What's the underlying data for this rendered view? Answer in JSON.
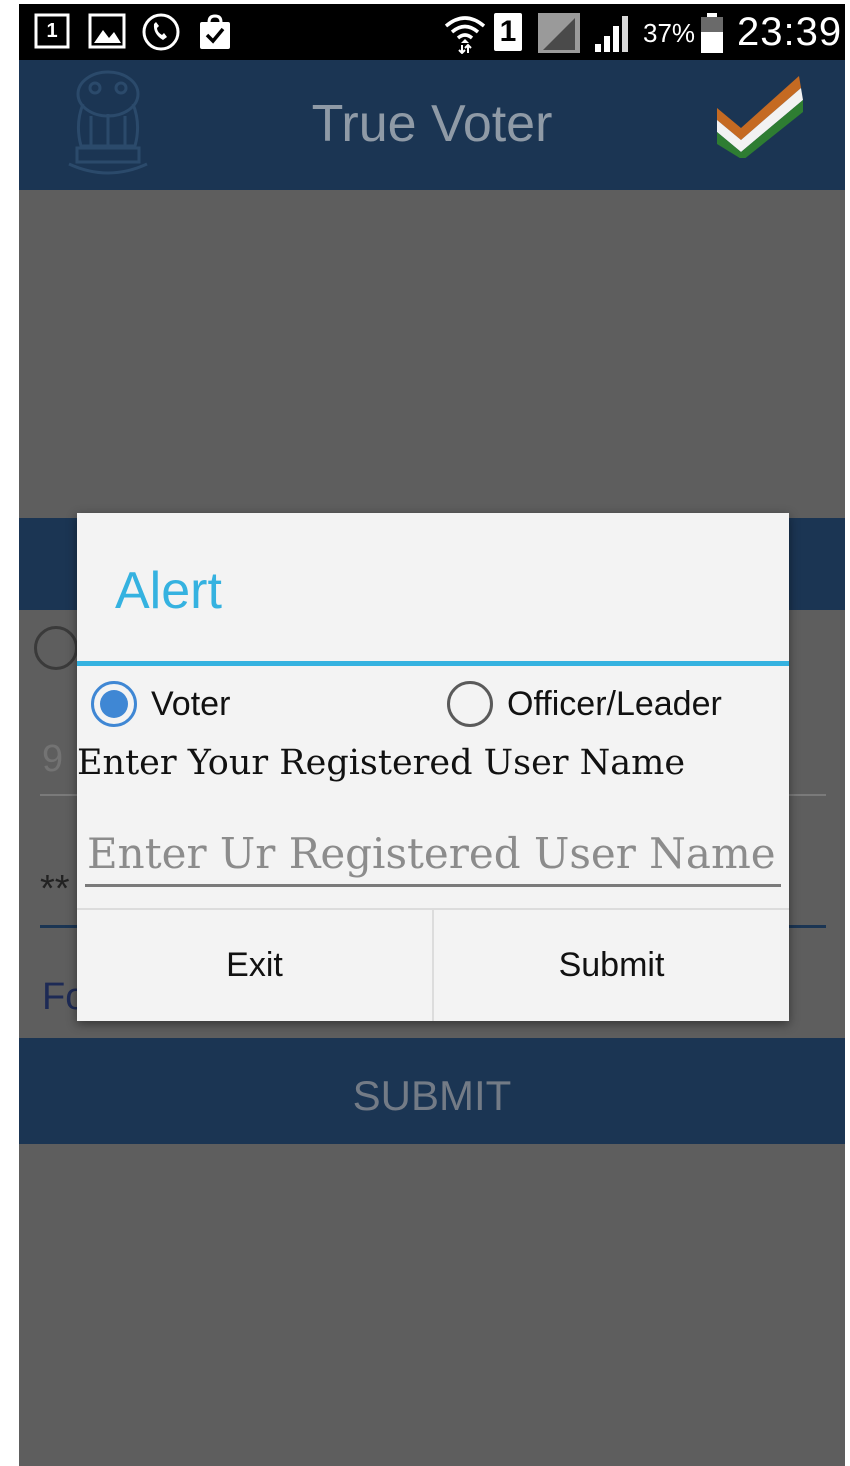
{
  "status_bar": {
    "notification_badge": "1",
    "sim_slot": "1",
    "battery_percent": "37%",
    "time": "23:39",
    "icons": [
      "notification-count-icon",
      "image-icon",
      "call-icon",
      "shopping-bag-check-icon",
      "wifi-icon",
      "sim-1-icon",
      "mobile-data-icon",
      "signal-icon",
      "battery-icon"
    ]
  },
  "app_bar": {
    "title": "True Voter",
    "emblem_icon": "national-emblem-icon",
    "logo_icon": "tricolor-check-logo-icon"
  },
  "background": {
    "hint_text": "9",
    "password_mask": "**",
    "forgot_text": "Fo",
    "submit_label": "SUBMIT"
  },
  "dialog": {
    "title": "Alert",
    "options": [
      {
        "label": "Voter",
        "selected": true
      },
      {
        "label": "Officer/Leader",
        "selected": false
      }
    ],
    "prompt": "Enter Your Registered User Name",
    "input": {
      "value": "",
      "placeholder": "Enter Ur Registered User Name"
    },
    "buttons": {
      "exit": "Exit",
      "submit": "Submit"
    }
  },
  "colors": {
    "app_bar": "#1b3553",
    "accent": "#35b2e0",
    "radio_selected": "#3f87d4",
    "dim_overlay": "#5e5e5e",
    "dialog_bg": "#f3f3f3"
  }
}
